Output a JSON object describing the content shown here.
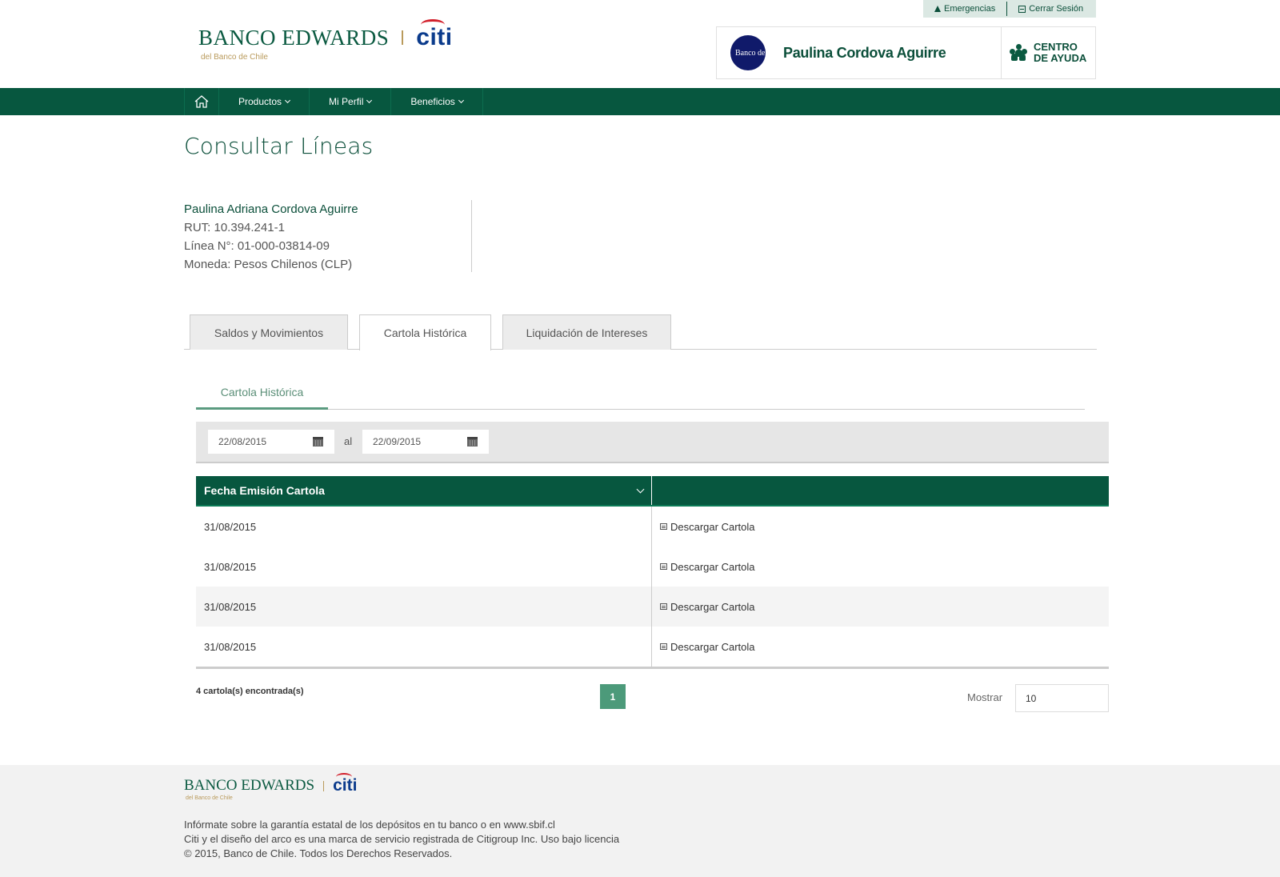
{
  "header": {
    "emergencias": "Emergencias",
    "cerrar_sesion": "Cerrar Sesión",
    "brand_name": "BANCO EDWARDS",
    "brand_citi": "citi",
    "brand_sub": "del Banco de Chile",
    "avatar_text": "Banco de Chile",
    "user_name": "Paulina Cordova Aguirre",
    "help_line1": "CENTRO",
    "help_line2": "DE AYUDA"
  },
  "nav": {
    "items": [
      {
        "label": "Productos"
      },
      {
        "label": "Mi Perfil"
      },
      {
        "label": "Beneficios"
      }
    ]
  },
  "page": {
    "title": "Consultar Líneas"
  },
  "account": {
    "name": "Paulina Adriana Cordova Aguirre",
    "rut": "RUT: 10.394.241-1",
    "linea": "Línea N°: 01-000-03814-09",
    "moneda": "Moneda: Pesos Chilenos (CLP)"
  },
  "tabs": [
    {
      "label": "Saldos y Movimientos"
    },
    {
      "label": "Cartola Histórica"
    },
    {
      "label": "Liquidación de Intereses"
    }
  ],
  "subtab": {
    "label": "Cartola Histórica"
  },
  "filter": {
    "from": "22/08/2015",
    "separator": "al",
    "to": "22/09/2015"
  },
  "table": {
    "header": "Fecha Emisión Cartola",
    "rows": [
      {
        "date": "31/08/2015",
        "action": "Descargar Cartola"
      },
      {
        "date": "31/08/2015",
        "action": "Descargar Cartola"
      },
      {
        "date": "31/08/2015",
        "action": "Descargar Cartola"
      },
      {
        "date": "31/08/2015",
        "action": "Descargar Cartola"
      }
    ]
  },
  "pagination": {
    "count": "4 cartola(s) encontrada(s)",
    "current_page": "1",
    "mostrar_label": "Mostrar",
    "mostrar_value": "10"
  },
  "footer": {
    "brand_name": "BANCO EDWARDS",
    "brand_citi": "citi",
    "brand_sub": "del Banco de Chile",
    "line1": "Infórmate sobre la garantía estatal de los depósitos en tu banco o en www.sbif.cl",
    "line2": "Citi y el diseño del arco es una marca de servicio registrada de Citigroup Inc. Uso bajo licencia",
    "line3": "© 2015, Banco de Chile. Todos los Derechos Reservados."
  },
  "colors": {
    "primary_green": "#07573f",
    "accent_green": "#4c9a7a",
    "gold": "#b99a5b",
    "citi_blue": "#0b3b8c"
  }
}
